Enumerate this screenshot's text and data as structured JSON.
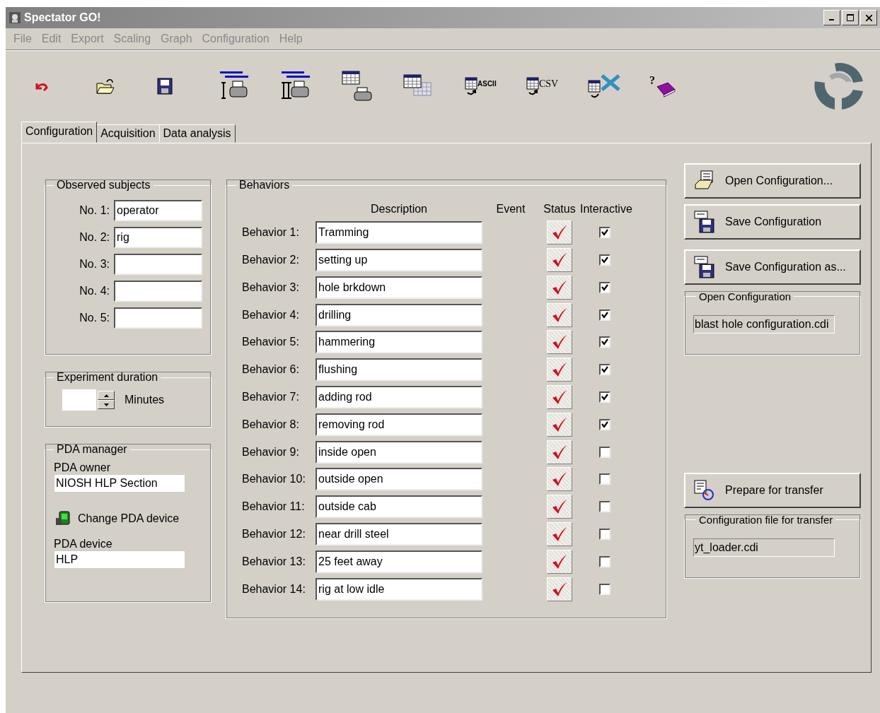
{
  "window": {
    "title": "Spectator GO!"
  },
  "menu": [
    "File",
    "Edit",
    "Export",
    "Scaling",
    "Graph",
    "Configuration",
    "Help"
  ],
  "toolbar": [
    {
      "kind": "undo"
    },
    {
      "kind": "open"
    },
    {
      "kind": "save"
    },
    {
      "kind": "print1"
    },
    {
      "kind": "print2"
    },
    {
      "kind": "tableprint"
    },
    {
      "kind": "tables"
    },
    {
      "kind": "export",
      "label": "ASCII"
    },
    {
      "kind": "export",
      "label": "CSV"
    },
    {
      "kind": "excel"
    },
    {
      "kind": "help",
      "label": "?"
    }
  ],
  "tabs": [
    {
      "label": "Configuration",
      "selected": true
    },
    {
      "label": "Acquisition",
      "selected": false
    },
    {
      "label": "Data analysis",
      "selected": false
    }
  ],
  "observed_subjects": {
    "title": "Observed subjects",
    "rows": [
      {
        "label": "No. 1:",
        "value": "operator"
      },
      {
        "label": "No. 2:",
        "value": "rig"
      },
      {
        "label": "No. 3:",
        "value": ""
      },
      {
        "label": "No. 4:",
        "value": ""
      },
      {
        "label": "No. 5:",
        "value": ""
      }
    ]
  },
  "experiment_duration": {
    "title": "Experiment duration",
    "unit": "Minutes"
  },
  "pda_manager": {
    "title": "PDA manager",
    "owner_label": "PDA owner",
    "owner": "NIOSH HLP Section",
    "change_button": "Change PDA device",
    "device_label": "PDA device",
    "device": "HLP"
  },
  "behaviors": {
    "title": "Behaviors",
    "columns": [
      "Description",
      "Event",
      "Status",
      "Interactive"
    ],
    "rows": [
      {
        "label": "Behavior 1:",
        "description": "Tramming",
        "status": true,
        "interactive": true
      },
      {
        "label": "Behavior 2:",
        "description": "setting up",
        "status": true,
        "interactive": true
      },
      {
        "label": "Behavior 3:",
        "description": "hole brkdown",
        "status": true,
        "interactive": true
      },
      {
        "label": "Behavior 4:",
        "description": "drilling",
        "status": true,
        "interactive": true
      },
      {
        "label": "Behavior 5:",
        "description": "hammering",
        "status": true,
        "interactive": true
      },
      {
        "label": "Behavior 6:",
        "description": "flushing",
        "status": true,
        "interactive": true
      },
      {
        "label": "Behavior 7:",
        "description": "adding rod",
        "status": true,
        "interactive": true
      },
      {
        "label": "Behavior 8:",
        "description": "removing rod",
        "status": true,
        "interactive": true
      },
      {
        "label": "Behavior 9:",
        "description": "inside open",
        "status": true,
        "interactive": false
      },
      {
        "label": "Behavior 10:",
        "description": "outside open",
        "status": true,
        "interactive": false
      },
      {
        "label": "Behavior 11:",
        "description": "outside cab",
        "status": true,
        "interactive": false
      },
      {
        "label": "Behavior 12:",
        "description": "near drill steel",
        "status": true,
        "interactive": false
      },
      {
        "label": "Behavior 13:",
        "description": "25 feet away",
        "status": true,
        "interactive": false
      },
      {
        "label": "Behavior 14:",
        "description": "rig at low idle",
        "status": true,
        "interactive": false
      }
    ]
  },
  "buttons": [
    "Open Configuration...",
    "Save Configuration",
    "Save Configuration as..."
  ],
  "open_configuration": {
    "title": "Open Configuration",
    "value": "blast hole configuration.cdi"
  },
  "prepare_button": "Prepare for transfer",
  "transfer_file": {
    "title": "Configuration file for transfer",
    "value": "yt_loader.cdi"
  }
}
